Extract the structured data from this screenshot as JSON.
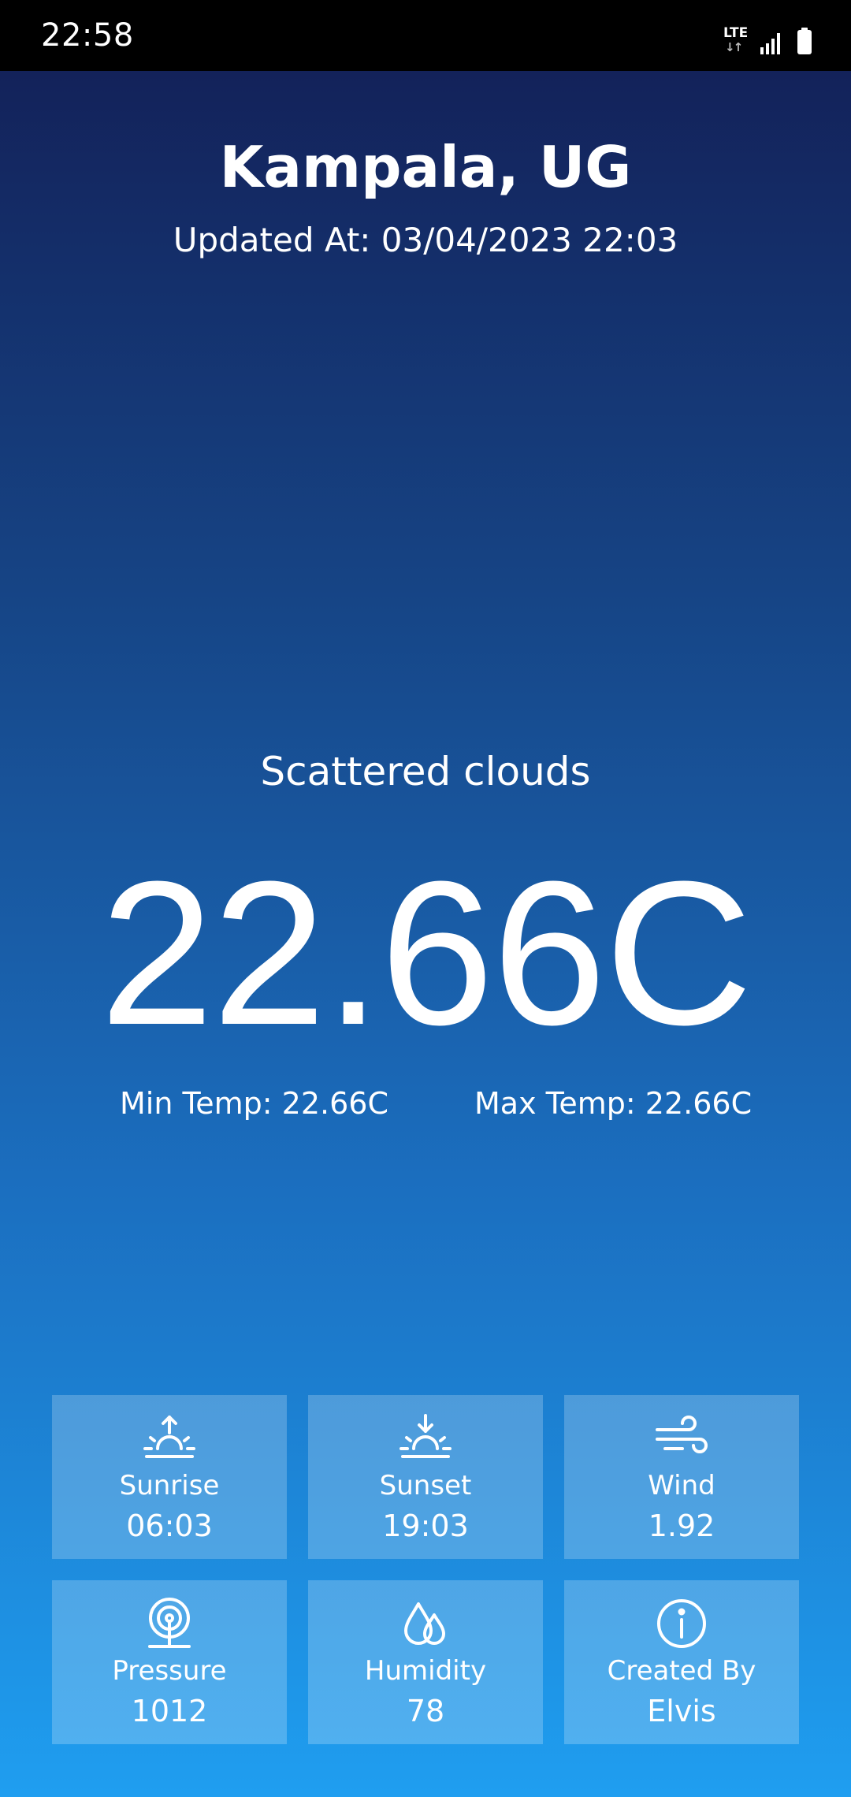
{
  "status_bar": {
    "time": "22:58",
    "network_label": "LTE"
  },
  "weather": {
    "city": "Kampala, UG",
    "updated_at": "Updated At: 03/04/2023 22:03",
    "condition": "Scattered clouds",
    "temperature": "22.66C",
    "min_temp": "Min Temp: 22.66C",
    "max_temp": "Max Temp: 22.66C"
  },
  "tiles": [
    {
      "icon": "sunrise-icon",
      "label": "Sunrise",
      "value": "06:03"
    },
    {
      "icon": "sunset-icon",
      "label": "Sunset",
      "value": "19:03"
    },
    {
      "icon": "wind-icon",
      "label": "Wind",
      "value": "1.92"
    },
    {
      "icon": "pressure-icon",
      "label": "Pressure",
      "value": "1012"
    },
    {
      "icon": "humidity-icon",
      "label": "Humidity",
      "value": "78"
    },
    {
      "icon": "info-icon",
      "label": "Created By",
      "value": "Elvis"
    }
  ],
  "colors": {
    "background_top": "#13225a",
    "background_bottom": "#1f9ef0",
    "text": "#ffffff"
  }
}
